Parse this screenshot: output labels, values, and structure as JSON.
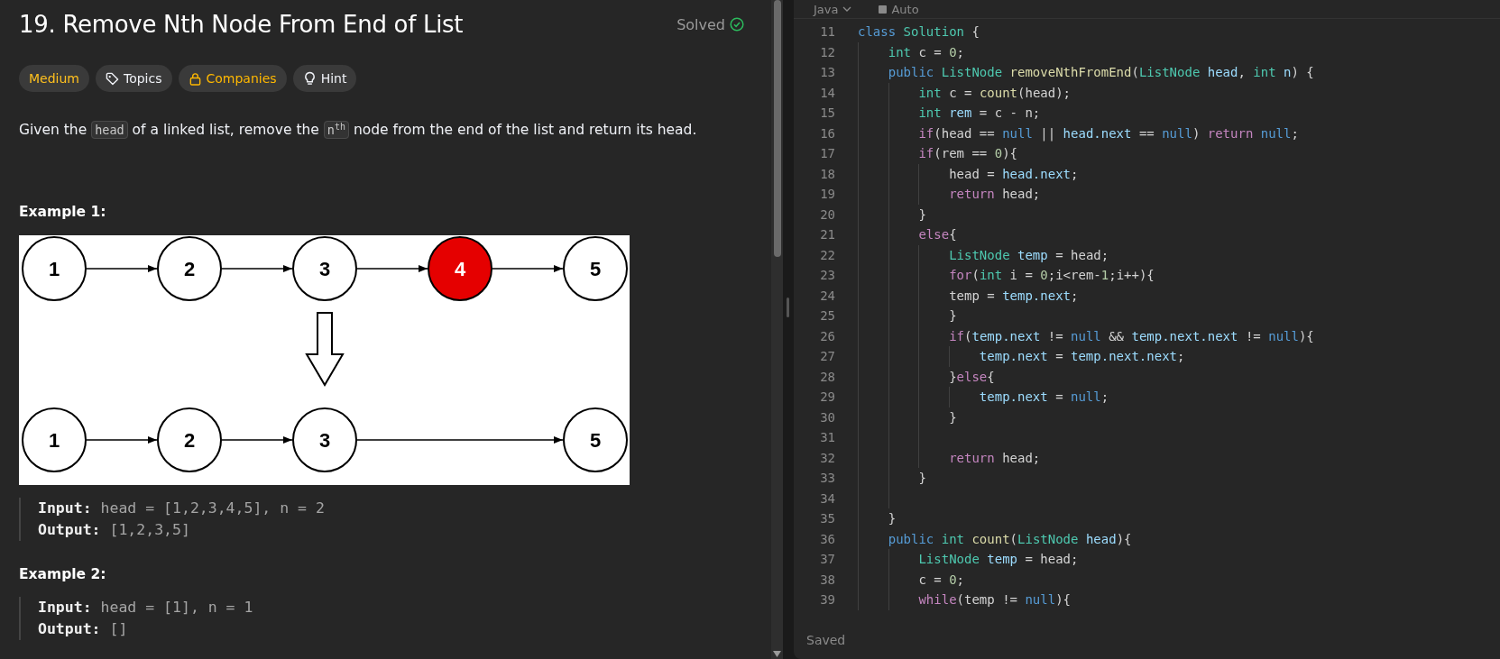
{
  "problem": {
    "title": "19. Remove Nth Node From End of List",
    "status": "Solved",
    "tags": [
      {
        "kind": "difficulty",
        "label": "Medium"
      },
      {
        "kind": "topics",
        "label": "Topics"
      },
      {
        "kind": "companies",
        "label": "Companies"
      },
      {
        "kind": "hint",
        "label": "Hint"
      }
    ],
    "description": [
      {
        "kind": "text",
        "text": "Given the "
      },
      {
        "kind": "code",
        "text": "head"
      },
      {
        "kind": "text",
        "text": " of a linked list, remove the "
      },
      {
        "kind": "code",
        "text": "n$^{th}$"
      },
      {
        "kind": "text",
        "text": " node from the end of the list and return its head."
      }
    ],
    "examples": [
      {
        "title": "Example 1:",
        "diagram": {
          "before": [
            {
              "kind": "node",
              "label": "1",
              "removed": false
            },
            {
              "kind": "node",
              "label": "2",
              "removed": false
            },
            {
              "kind": "node",
              "label": "3",
              "removed": false
            },
            {
              "kind": "node",
              "label": "4",
              "removed": true
            },
            {
              "kind": "node",
              "label": "5",
              "removed": false
            }
          ],
          "after": [
            {
              "kind": "node",
              "label": "1",
              "removed": false
            },
            {
              "kind": "node",
              "label": "2",
              "removed": false
            },
            {
              "kind": "node",
              "label": "3",
              "removed": false
            },
            {
              "kind": "gap"
            },
            {
              "kind": "node",
              "label": "5",
              "removed": false
            }
          ]
        },
        "lines": [
          "**Input:** head = [1,2,3,4,5], n = 2",
          "**Output:** [1,2,3,5]"
        ]
      },
      {
        "title": "Example 2:",
        "lines": [
          "**Input:** head = [1], n = 1",
          "**Output:** []"
        ]
      }
    ]
  },
  "editor": {
    "language": "Java",
    "mode": "Auto",
    "status": "Saved",
    "lines": [
      {
        "number": "11",
        "tokens": [
          {
            "kind": "decl",
            "text": "class"
          },
          {
            "kind": "type",
            "text": " Solution"
          },
          {
            "kind": "plain",
            "text": " {"
          }
        ]
      },
      {
        "number": "12",
        "tokens": [
          {
            "kind": "type",
            "text": "    int"
          },
          {
            "kind": "plain",
            "text": " c = "
          },
          {
            "kind": "num",
            "text": "0"
          },
          {
            "kind": "plain",
            "text": ";"
          }
        ]
      },
      {
        "number": "13",
        "tokens": [
          {
            "kind": "decl",
            "text": "    public"
          },
          {
            "kind": "type",
            "text": " ListNode"
          },
          {
            "kind": "fn",
            "text": " removeNthFromEnd"
          },
          {
            "kind": "plain",
            "text": "("
          },
          {
            "kind": "type",
            "text": "ListNode"
          },
          {
            "kind": "var",
            "text": " head"
          },
          {
            "kind": "plain",
            "text": ", "
          },
          {
            "kind": "type",
            "text": "int"
          },
          {
            "kind": "var",
            "text": " n"
          },
          {
            "kind": "plain",
            "text": ") {"
          }
        ]
      },
      {
        "number": "14",
        "tokens": [
          {
            "kind": "type",
            "text": "        int"
          },
          {
            "kind": "plain",
            "text": " c = "
          },
          {
            "kind": "fn",
            "text": "count"
          },
          {
            "kind": "plain",
            "text": "(head);"
          }
        ]
      },
      {
        "number": "15",
        "tokens": [
          {
            "kind": "type",
            "text": "        int"
          },
          {
            "kind": "var",
            "text": " rem"
          },
          {
            "kind": "plain",
            "text": " = c - n;"
          }
        ]
      },
      {
        "number": "16",
        "tokens": [
          {
            "kind": "kw",
            "text": "        if"
          },
          {
            "kind": "plain",
            "text": "(head == "
          },
          {
            "kind": "decl",
            "text": "null"
          },
          {
            "kind": "plain",
            "text": " || "
          },
          {
            "kind": "var",
            "text": "head.next"
          },
          {
            "kind": "plain",
            "text": " == "
          },
          {
            "kind": "decl",
            "text": "null"
          },
          {
            "kind": "plain",
            "text": ") "
          },
          {
            "kind": "kw",
            "text": "return"
          },
          {
            "kind": "decl",
            "text": " null"
          },
          {
            "kind": "plain",
            "text": ";"
          }
        ]
      },
      {
        "number": "17",
        "tokens": [
          {
            "kind": "kw",
            "text": "        if"
          },
          {
            "kind": "plain",
            "text": "(rem == "
          },
          {
            "kind": "num",
            "text": "0"
          },
          {
            "kind": "plain",
            "text": "){"
          }
        ]
      },
      {
        "number": "18",
        "tokens": [
          {
            "kind": "plain",
            "text": "            head = "
          },
          {
            "kind": "var",
            "text": "head.next"
          },
          {
            "kind": "plain",
            "text": ";"
          }
        ]
      },
      {
        "number": "19",
        "tokens": [
          {
            "kind": "kw",
            "text": "            return"
          },
          {
            "kind": "plain",
            "text": " head;"
          }
        ]
      },
      {
        "number": "20",
        "tokens": [
          {
            "kind": "plain",
            "text": "        }"
          }
        ]
      },
      {
        "number": "21",
        "tokens": [
          {
            "kind": "kw",
            "text": "        else"
          },
          {
            "kind": "plain",
            "text": "{"
          }
        ]
      },
      {
        "number": "22",
        "tokens": [
          {
            "kind": "type",
            "text": "            ListNode"
          },
          {
            "kind": "var",
            "text": " temp"
          },
          {
            "kind": "plain",
            "text": " = head;"
          }
        ]
      },
      {
        "number": "23",
        "tokens": [
          {
            "kind": "kw",
            "text": "            for"
          },
          {
            "kind": "plain",
            "text": "("
          },
          {
            "kind": "type",
            "text": "int"
          },
          {
            "kind": "plain",
            "text": " i = "
          },
          {
            "kind": "num",
            "text": "0"
          },
          {
            "kind": "plain",
            "text": ";i<rem-"
          },
          {
            "kind": "num",
            "text": "1"
          },
          {
            "kind": "plain",
            "text": ";i++){"
          }
        ]
      },
      {
        "number": "24",
        "tokens": [
          {
            "kind": "plain",
            "text": "            temp = "
          },
          {
            "kind": "var",
            "text": "temp.next"
          },
          {
            "kind": "plain",
            "text": ";"
          }
        ]
      },
      {
        "number": "25",
        "tokens": [
          {
            "kind": "plain",
            "text": "            }"
          }
        ]
      },
      {
        "number": "26",
        "tokens": [
          {
            "kind": "kw",
            "text": "            if"
          },
          {
            "kind": "plain",
            "text": "("
          },
          {
            "kind": "var",
            "text": "temp.next"
          },
          {
            "kind": "plain",
            "text": " != "
          },
          {
            "kind": "decl",
            "text": "null"
          },
          {
            "kind": "plain",
            "text": " && "
          },
          {
            "kind": "var",
            "text": "temp.next.next"
          },
          {
            "kind": "plain",
            "text": " != "
          },
          {
            "kind": "decl",
            "text": "null"
          },
          {
            "kind": "plain",
            "text": "){"
          }
        ]
      },
      {
        "number": "27",
        "tokens": [
          {
            "kind": "var",
            "text": "                temp.next"
          },
          {
            "kind": "plain",
            "text": " = "
          },
          {
            "kind": "var",
            "text": "temp.next.next"
          },
          {
            "kind": "plain",
            "text": ";"
          }
        ]
      },
      {
        "number": "28",
        "tokens": [
          {
            "kind": "plain",
            "text": "            }"
          },
          {
            "kind": "kw",
            "text": "else"
          },
          {
            "kind": "plain",
            "text": "{"
          }
        ]
      },
      {
        "number": "29",
        "tokens": [
          {
            "kind": "var",
            "text": "                temp.next"
          },
          {
            "kind": "plain",
            "text": " = "
          },
          {
            "kind": "decl",
            "text": "null"
          },
          {
            "kind": "plain",
            "text": ";"
          }
        ]
      },
      {
        "number": "30",
        "tokens": [
          {
            "kind": "plain",
            "text": "            }"
          }
        ]
      },
      {
        "number": "31"
      },
      {
        "number": "32",
        "tokens": [
          {
            "kind": "kw",
            "text": "            return"
          },
          {
            "kind": "plain",
            "text": " head;"
          }
        ]
      },
      {
        "number": "33",
        "tokens": [
          {
            "kind": "plain",
            "text": "        }"
          }
        ]
      },
      {
        "number": "34"
      },
      {
        "number": "35",
        "tokens": [
          {
            "kind": "plain",
            "text": "    }"
          }
        ]
      },
      {
        "number": "36",
        "tokens": [
          {
            "kind": "decl",
            "text": "    public"
          },
          {
            "kind": "type",
            "text": " int"
          },
          {
            "kind": "fn",
            "text": " count"
          },
          {
            "kind": "plain",
            "text": "("
          },
          {
            "kind": "type",
            "text": "ListNode"
          },
          {
            "kind": "var",
            "text": " head"
          },
          {
            "kind": "plain",
            "text": "){"
          }
        ]
      },
      {
        "number": "37",
        "tokens": [
          {
            "kind": "type",
            "text": "        ListNode"
          },
          {
            "kind": "var",
            "text": " temp"
          },
          {
            "kind": "plain",
            "text": " = head;"
          }
        ]
      },
      {
        "number": "38",
        "tokens": [
          {
            "kind": "plain",
            "text": "        c = "
          },
          {
            "kind": "num",
            "text": "0"
          },
          {
            "kind": "plain",
            "text": ";"
          }
        ]
      },
      {
        "number": "39",
        "tokens": [
          {
            "kind": "kw",
            "text": "        while"
          },
          {
            "kind": "plain",
            "text": "(temp != "
          },
          {
            "kind": "decl",
            "text": "null"
          },
          {
            "kind": "plain",
            "text": "){"
          }
        ]
      }
    ]
  }
}
